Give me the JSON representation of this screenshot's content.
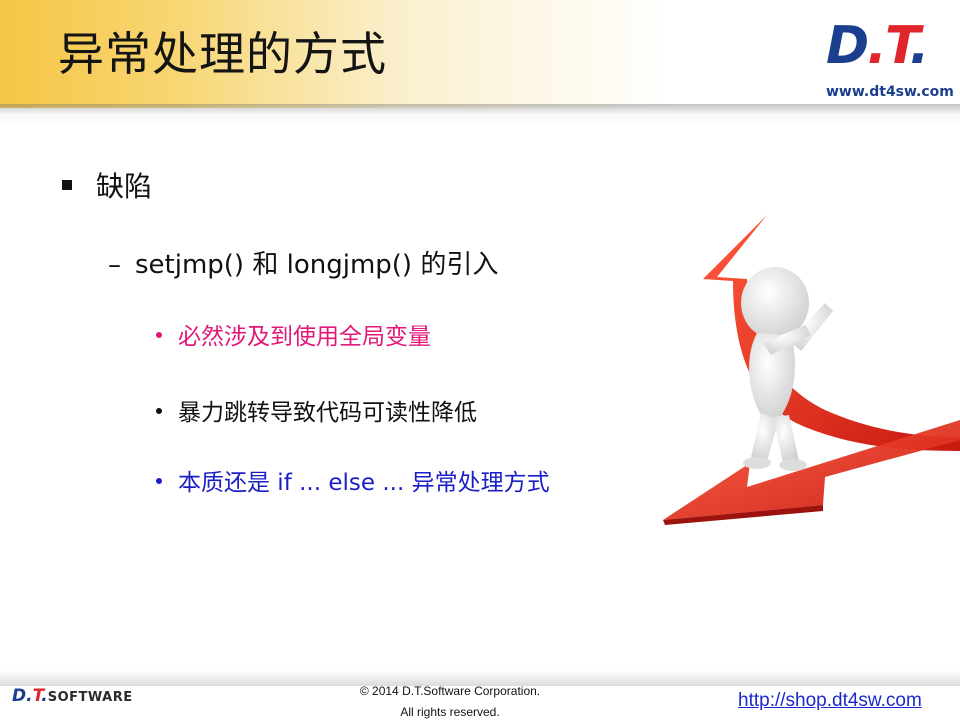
{
  "slide": {
    "title": "异常处理的方式",
    "logo": {
      "mark_left": "D",
      "mark_dot1": ".",
      "mark_right": "T",
      "mark_dot2": ".",
      "url": "www.dt4sw.com"
    },
    "bullets": {
      "level1": "缺陷",
      "level2": "setjmp() 和 longjmp() 的引入",
      "level3": [
        {
          "text": "必然涉及到使用全局变量",
          "color": "#e21777"
        },
        {
          "text": "暴力跳转导致代码可读性降低",
          "color": "#111111"
        },
        {
          "text": "本质还是 if ... else ... 异常处理方式",
          "color": "#1a1ec6"
        }
      ]
    },
    "illustration": "red-arrow-with-figure-image"
  },
  "footer": {
    "brand_dt": "D.",
    "brand_t": "T",
    "brand_dot": ".",
    "brand_software": "SOFTWARE",
    "copyright_line1": "© 2014 D.T.Software Corporation.",
    "copyright_line2": "All rights reserved.",
    "link": "http://shop.dt4sw.com"
  }
}
